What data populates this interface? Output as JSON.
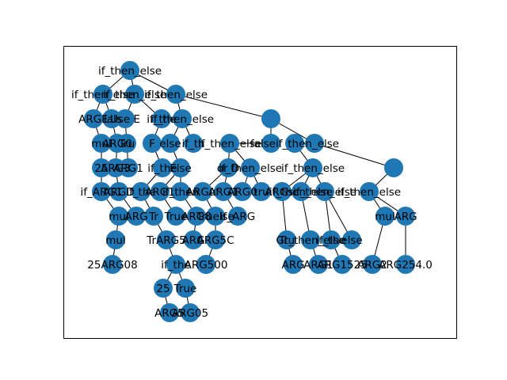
{
  "diagram": {
    "type": "tree",
    "node_color": "#1f77b4",
    "edge_color": "#000000",
    "frame_color": "#000000",
    "labels": {
      "root": "if_then_else",
      "l1a": "if_then_else",
      "l1b": "if_then_else",
      "l1c": "if_then_else",
      "l2a": "ARG1",
      "l2b": "Fals",
      "l2c": "Use E",
      "l2d": "if_the",
      "l2e": "if_then_else",
      "l3a": "mul",
      "l3b": "ARG0",
      "l3c": "Tru",
      "l3d": "F",
      "l3e": "else",
      "l3f": "if_th",
      "l3g": "if_then_else",
      "l3h": "falseif_then_else",
      "l4a": "25",
      "l4b": "ARG3",
      "l4c": "ARG1",
      "l4d": "if_the",
      "l4e": "Else",
      "l4f": "or D",
      "l4g": "if_then_else",
      "l4h": "if_then_else",
      "l4i": "if_then_else",
      "l5a": "if_ARG1",
      "l5b": "ARGD",
      "l5c": "if_the",
      "l5d": "ARG1",
      "l5e": "if_then",
      "l5f": "ARGuf",
      "l5g": "ARG1",
      "l5h": "ARG0",
      "l5i": "tru",
      "l5j": "ARGsc",
      "l5k": "if_then_else",
      "l5l": "if_then_else",
      "l6a": "mul",
      "l6b": "ARG",
      "l6c": "Tr",
      "l6d": "True",
      "l6e": "ARG8",
      "l6f": "Truelse",
      "l6g": "if_ARG",
      "l6h": "mul",
      "l6i": "ARG",
      "l7a": "mul",
      "l7b": "TrARG5",
      "l7c": "ARG",
      "l7d": "ARG5C",
      "l7e": "Tru",
      "l7f": "Gt_then_else",
      "l7g": "if_the",
      "l7h": "else",
      "l8a": "25ARG08",
      "l8b": "if_the",
      "l8c": "ARG500",
      "l8d": "ARG",
      "l8e": "ARG1",
      "l8f": "ARG1525",
      "l8g": "ARG2",
      "l8h": "ARG254.0",
      "l9a": "25",
      "l9b": "True",
      "l10a": "ARG5",
      "l10b": "ARG05"
    }
  }
}
